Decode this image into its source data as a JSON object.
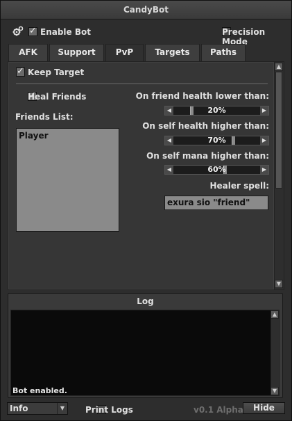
{
  "window": {
    "title": "CandyBot"
  },
  "header": {
    "enable_bot_label": "Enable Bot",
    "enable_bot_checked": true,
    "precision_mode_label": "Precision Mode",
    "precision_mode_checked": false
  },
  "tabs": [
    {
      "label": "AFK",
      "active": false
    },
    {
      "label": "Support",
      "active": false
    },
    {
      "label": "PvP",
      "active": true
    },
    {
      "label": "Targets",
      "active": false
    },
    {
      "label": "Paths",
      "active": false
    }
  ],
  "pvp": {
    "keep_target_label": "Keep Target",
    "keep_target_checked": true,
    "heal_friends_label": "Heal Friends",
    "heal_friends_checked": true,
    "friends_list_label": "Friends List:",
    "friends": [
      "Player"
    ],
    "friend_health_label": "On friend health lower than:",
    "friend_health_value": "20%",
    "friend_health_level": 0.2,
    "self_health_label": "On self health higher than:",
    "self_health_value": "70%",
    "self_health_level": 0.7,
    "self_mana_label": "On self mana higher than:",
    "self_mana_value": "60%",
    "self_mana_level": 0.6,
    "healer_spell_label": "Healer spell:",
    "healer_spell_value": "exura sio \"friend\""
  },
  "log": {
    "title": "Log",
    "lines": [
      "Bot enabled."
    ]
  },
  "footer": {
    "log_level_value": "Info",
    "print_logs_label": "Print Logs",
    "print_logs_checked": false,
    "version": "v0.1 Alpha",
    "hide_label": "Hide"
  }
}
